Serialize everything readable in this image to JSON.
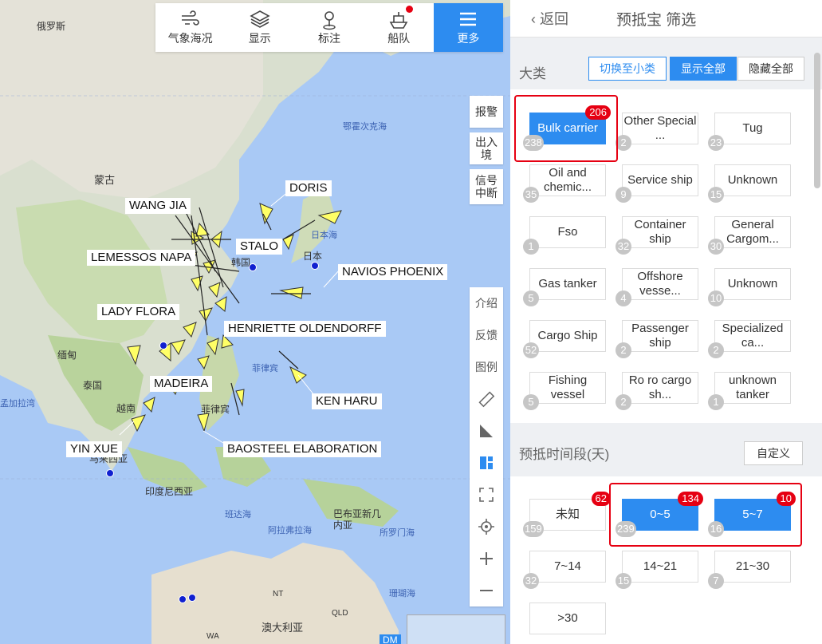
{
  "top_toolbar": {
    "items": [
      {
        "label": "气象海况",
        "icon": "wind-icon"
      },
      {
        "label": "显示",
        "icon": "layers-icon"
      },
      {
        "label": "标注",
        "icon": "map-pin-icon"
      },
      {
        "label": "船队",
        "icon": "ship-icon"
      },
      {
        "label": "更多",
        "icon": "menu-icon"
      }
    ]
  },
  "map": {
    "places": [
      "俄罗斯",
      "蒙古",
      "缅甸",
      "泰国",
      "越南",
      "马来西亚",
      "印度尼西亚",
      "班达海",
      "阿拉弗拉海",
      "巴布亚新几内亚",
      "所罗门海",
      "珊瑚海",
      "澳大利亚",
      "菲律宾",
      "菲律宾",
      "日本",
      "韩国",
      "日本海",
      "鄂霍次克海",
      "孟加拉湾",
      "NT",
      "QLD",
      "WA"
    ],
    "ship_labels": [
      "WANG JIA",
      "DORIS",
      "STALO",
      "LEMESSOS NAPA",
      "NAVIOS PHOENIX",
      "LADY FLORA",
      "HENRIETTE OLDENDORFF",
      "MADEIRA",
      "KEN HARU",
      "YIN XUE",
      "BAOSTEEL ELABORATION"
    ],
    "side_buttons": [
      "报警",
      "出入境",
      "信号中断"
    ],
    "tools": [
      "介绍",
      "反馈",
      "图例"
    ],
    "tool_icons": [
      "ruler-icon",
      "angle-icon",
      "layout-icon",
      "fullscreen-icon",
      "locate-icon",
      "zoom-in-icon",
      "zoom-out-icon"
    ],
    "dm_label": "DM"
  },
  "panel": {
    "back_label": "返回",
    "title": "预抵宝 筛选",
    "category": {
      "title": "大类",
      "switch_label": "切换至小类",
      "show_all_label": "显示全部",
      "hide_all_label": "隐藏全部",
      "tiles": [
        {
          "label": "Bulk carrier",
          "count": "238",
          "badge": "206",
          "selected": true
        },
        {
          "label": "Other Special ...",
          "count": "2"
        },
        {
          "label": "Tug",
          "count": "23"
        },
        {
          "label": "Oil and chemic...",
          "count": "35"
        },
        {
          "label": "Service ship",
          "count": "9"
        },
        {
          "label": "Unknown",
          "count": "15"
        },
        {
          "label": "Fso",
          "count": "1"
        },
        {
          "label": "Container ship",
          "count": "32"
        },
        {
          "label": "General Cargom...",
          "count": "30"
        },
        {
          "label": "Gas tanker",
          "count": "5"
        },
        {
          "label": "Offshore vesse...",
          "count": "4"
        },
        {
          "label": "Unknown",
          "count": "10"
        },
        {
          "label": "Cargo Ship",
          "count": "52"
        },
        {
          "label": "Passenger ship",
          "count": "2"
        },
        {
          "label": "Specialized ca...",
          "count": "2"
        },
        {
          "label": "Fishing vessel",
          "count": "5"
        },
        {
          "label": "Ro ro cargo sh...",
          "count": "2"
        },
        {
          "label": "unknown tanker",
          "count": "1"
        }
      ]
    },
    "period": {
      "title": "预抵时间段(天)",
      "custom_label": "自定义",
      "tiles": [
        {
          "label": "未知",
          "count": "159",
          "badge": "62"
        },
        {
          "label": "0~5",
          "count": "239",
          "badge": "134",
          "selected": true
        },
        {
          "label": "5~7",
          "count": "16",
          "badge": "10",
          "selected": true
        },
        {
          "label": "7~14",
          "count": "32"
        },
        {
          "label": "14~21",
          "count": "15"
        },
        {
          "label": "21~30",
          "count": "7"
        },
        {
          "label": ">30",
          "count": ""
        }
      ]
    }
  },
  "colors": {
    "accent": "#2d8cf0",
    "alert": "#e60012",
    "ship": "#ffff66"
  }
}
